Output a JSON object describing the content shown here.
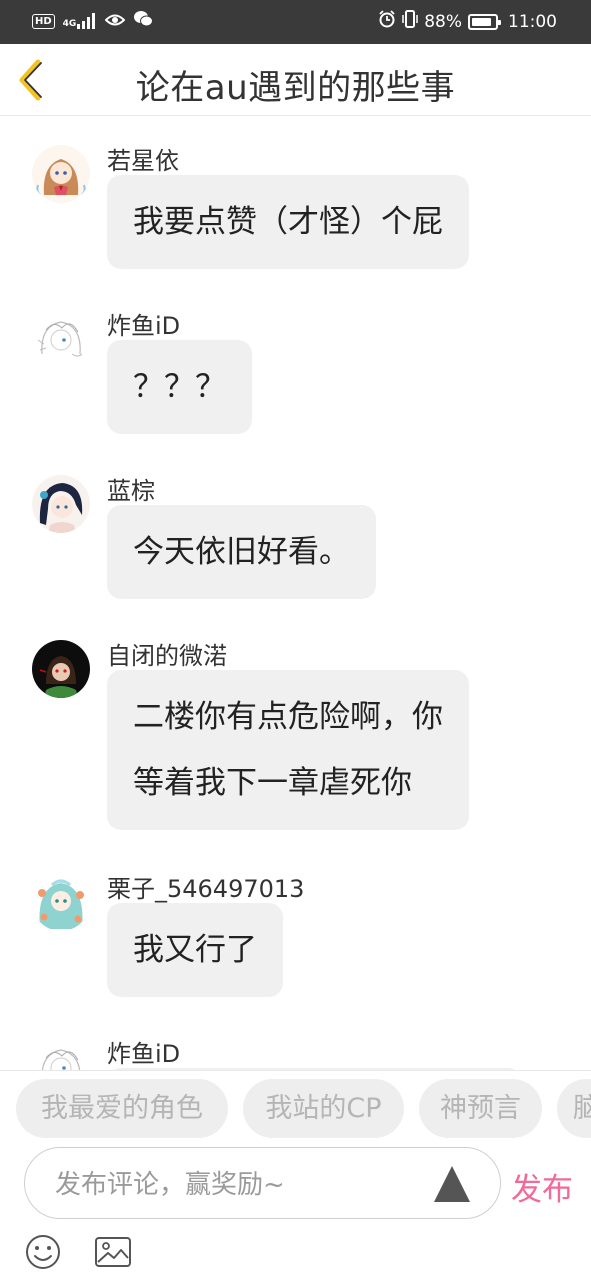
{
  "status_bar": {
    "left_icons": [
      "hd-badge",
      "4g-signal-icon",
      "eye-icon",
      "wechat-icon"
    ],
    "hd": "HD",
    "network": "4G",
    "right_icons": [
      "alarm-icon",
      "vibrate-icon"
    ],
    "battery": "88%",
    "battery_level": 0.88,
    "time": "11:00"
  },
  "header": {
    "back_icon": "chevron-left-icon",
    "title": "论在au遇到的那些事",
    "accent_color": "#f2c321"
  },
  "messages": [
    {
      "user": "若星依",
      "avatar": "anime-girl-avatar",
      "lines": [
        "我要点赞（才怪）个屁"
      ]
    },
    {
      "user": "炸鱼iD",
      "avatar": "sketch-avatar",
      "lines": [
        "？？？"
      ]
    },
    {
      "user": "蓝棕",
      "avatar": "dark-hair-avatar",
      "lines": [
        "今天依旧好看。"
      ]
    },
    {
      "user": "自闭的微渃",
      "avatar": "dark-circle-avatar",
      "lines": [
        "二楼你有点危险啊，你",
        "等着我下一章虐死你"
      ]
    },
    {
      "user": "栗子_546497013",
      "avatar": "teal-hair-avatar",
      "lines": [
        "我又行了"
      ]
    },
    {
      "user": "炸鱼iD",
      "avatar": "sketch-avatar",
      "lines": [
        ""
      ]
    }
  ],
  "tags": [
    "我最爱的角色",
    "我站的CP",
    "神预言",
    "脑"
  ],
  "input": {
    "placeholder": "发布评论，赢奖励~",
    "send_icon": "triangle-up-icon",
    "publish_label": "发布",
    "publish_color": "#f06a9a"
  },
  "bottom_icons": [
    "emoji-icon",
    "image-icon"
  ]
}
